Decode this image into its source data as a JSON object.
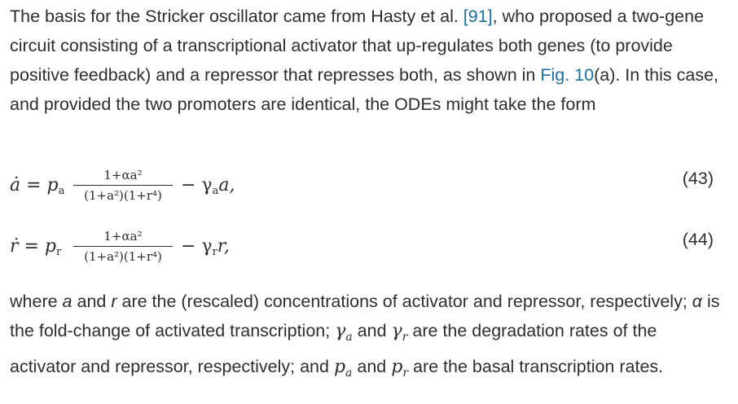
{
  "paragraph1": {
    "text_before_ref": "The basis for the Stricker oscillator came from Hasty et al. ",
    "ref_label": "[91]",
    "text_after_ref": ", who proposed a two-gene circuit consisting of a transcriptional activator that up-regulates both genes (to provide positive feedback) and a repressor that represses both, as shown in ",
    "fig_label": "Fig. 10",
    "text_after_fig": "(a). In this case, and provided the two promoters are identical, the ODEs might take the form"
  },
  "equations": [
    {
      "lhs": "ȧ = p",
      "lhs_sub": "a",
      "numerator": "1+αa²",
      "denominator": "(1+a²)(1+r⁴)",
      "rhs": "− γ",
      "rhs_sub": "a",
      "rhs_tail": "a,",
      "number": "(43)"
    },
    {
      "lhs": "ṙ = p",
      "lhs_sub": "r",
      "numerator": "1+αa²",
      "denominator": "(1+a²)(1+r⁴)",
      "rhs": "− γ",
      "rhs_sub": "r",
      "rhs_tail": "r,",
      "number": "(44)"
    }
  ],
  "paragraph2": {
    "t1": "where ",
    "v1": "a",
    "t2": " and ",
    "v2": "r",
    "t3": " are the (rescaled) concentrations of activator and repressor, respectively; ",
    "v3": "α",
    "t4": " is the fold-change of activated transcription; ",
    "v4": "γ",
    "v4_sub": "a",
    "t5": " and ",
    "v5": "γ",
    "v5_sub": "r",
    "t6": " are the degradation rates of the activator and repressor, respectively; and ",
    "v6": "p",
    "v6_sub": "a",
    "t7": " and ",
    "v7": "p",
    "v7_sub": "r",
    "t8": " are the basal transcription rates."
  }
}
